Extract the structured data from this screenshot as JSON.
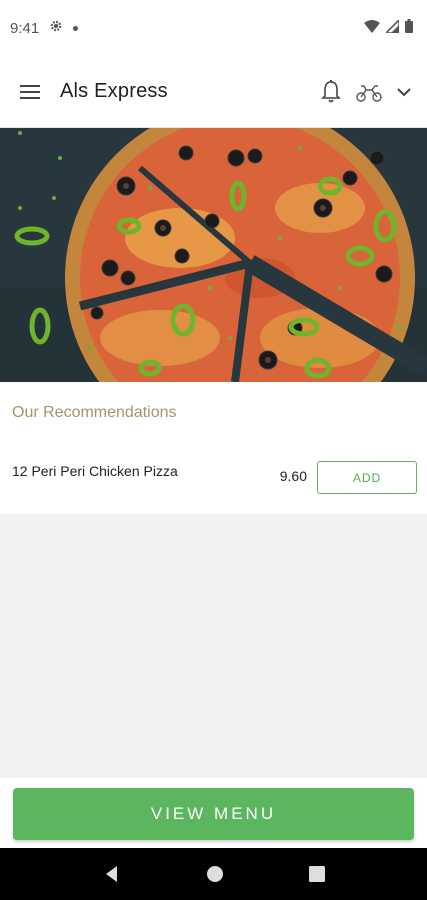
{
  "status_bar": {
    "time": "9:41",
    "icons": [
      "gear-icon",
      "dot-icon",
      "wifi-icon",
      "signal-icon",
      "battery-icon"
    ]
  },
  "app_bar": {
    "title": "Als Express",
    "icons": [
      "menu-icon",
      "bell-icon",
      "scooter-icon",
      "chevron-down-icon"
    ]
  },
  "hero": {
    "description_icon": "pizza-image"
  },
  "recommendations": {
    "title": "Our Recommendations",
    "items": [
      {
        "name": "12 Peri Peri Chicken Pizza",
        "price": "9.60",
        "action_label": "ADD"
      }
    ]
  },
  "footer": {
    "view_menu_label": "VIEW MENU"
  },
  "nav": {
    "icons": [
      "back-icon",
      "home-icon",
      "recents-icon"
    ]
  },
  "colors": {
    "accent_green": "#5cb660",
    "recommendations_title": "#a5946a",
    "background": "#f2f2f2"
  }
}
